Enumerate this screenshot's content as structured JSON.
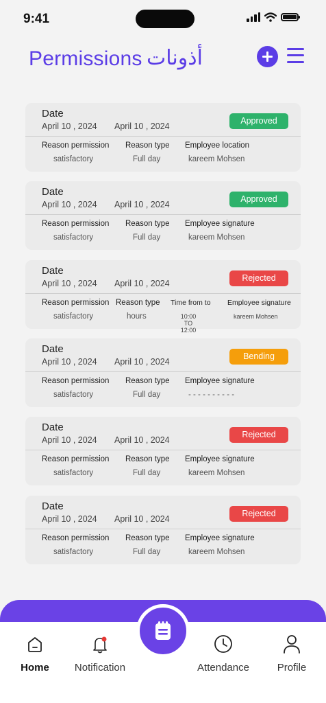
{
  "status_bar": {
    "time": "9:41"
  },
  "header": {
    "title_en": "Permissions",
    "title_ar": "أذونات"
  },
  "cards": [
    {
      "date_label": "Date",
      "date_from": "April 10 , 2024",
      "date_to": "April 10 , 2024",
      "status": "Approved",
      "status_color": "#2eb26b",
      "columns": [
        {
          "label": "Reason permission",
          "value": "satisfactory"
        },
        {
          "label": "Reason type",
          "value": "Full day"
        },
        {
          "label": "Employee location",
          "value": "kareem Mohsen"
        }
      ]
    },
    {
      "date_label": "Date",
      "date_from": "April 10 , 2024",
      "date_to": "April 10 , 2024",
      "status": "Approved",
      "status_color": "#2eb26b",
      "columns": [
        {
          "label": "Reason permission",
          "value": "satisfactory"
        },
        {
          "label": "Reason type",
          "value": "Full day"
        },
        {
          "label": "Employee signature",
          "value": "kareem Mohsen"
        }
      ]
    },
    {
      "date_label": "Date",
      "date_from": "April 10 , 2024",
      "date_to": "April 10 , 2024",
      "status": "Rejected",
      "status_color": "#e94747",
      "columns": [
        {
          "label": "Reason permission",
          "value": "satisfactory"
        },
        {
          "label": "Reason type",
          "value": "hours"
        },
        {
          "label": "Time from to",
          "value": "10:00 TO 12:00"
        },
        {
          "label": "Employee signature",
          "value": "kareem Mohsen"
        }
      ]
    },
    {
      "date_label": "Date",
      "date_from": "April 10 , 2024",
      "date_to": "April 10 , 2024",
      "status": "Bending",
      "status_color": "#f59e0b",
      "columns": [
        {
          "label": "Reason permission",
          "value": "satisfactory"
        },
        {
          "label": "Reason type",
          "value": "Full day"
        },
        {
          "label": "Employee signature",
          "value": "- - - - - - - - - -"
        }
      ]
    },
    {
      "date_label": "Date",
      "date_from": "April 10 , 2024",
      "date_to": "April 10 , 2024",
      "status": "Rejected",
      "status_color": "#e94747",
      "columns": [
        {
          "label": "Reason permission",
          "value": "satisfactory"
        },
        {
          "label": "Reason type",
          "value": "Full day"
        },
        {
          "label": "Employee signature",
          "value": "kareem Mohsen"
        }
      ]
    },
    {
      "date_label": "Date",
      "date_from": "April 10 , 2024",
      "date_to": "April 10 , 2024",
      "status": "Rejected",
      "status_color": "#e94747",
      "columns": [
        {
          "label": "Reason permission",
          "value": "satisfactory"
        },
        {
          "label": "Reason type",
          "value": "Full day"
        },
        {
          "label": "Employee signature",
          "value": "kareem Mohsen"
        }
      ]
    }
  ],
  "bottom_nav": {
    "items": [
      {
        "label": "Home",
        "icon": "home-icon",
        "active": true
      },
      {
        "label": "Notification",
        "icon": "bell-icon",
        "active": false,
        "has_dot": true
      },
      {
        "label": "Attendance",
        "icon": "clock-icon",
        "active": false
      },
      {
        "label": "Profile",
        "icon": "user-icon",
        "active": false
      }
    ],
    "center_icon": "clipboard-icon"
  },
  "colors": {
    "accent": "#5b3de6",
    "nav_bar": "#6a42e6",
    "approved": "#2eb26b",
    "rejected": "#e94747",
    "pending": "#f59e0b",
    "notification_dot": "#e53935"
  }
}
